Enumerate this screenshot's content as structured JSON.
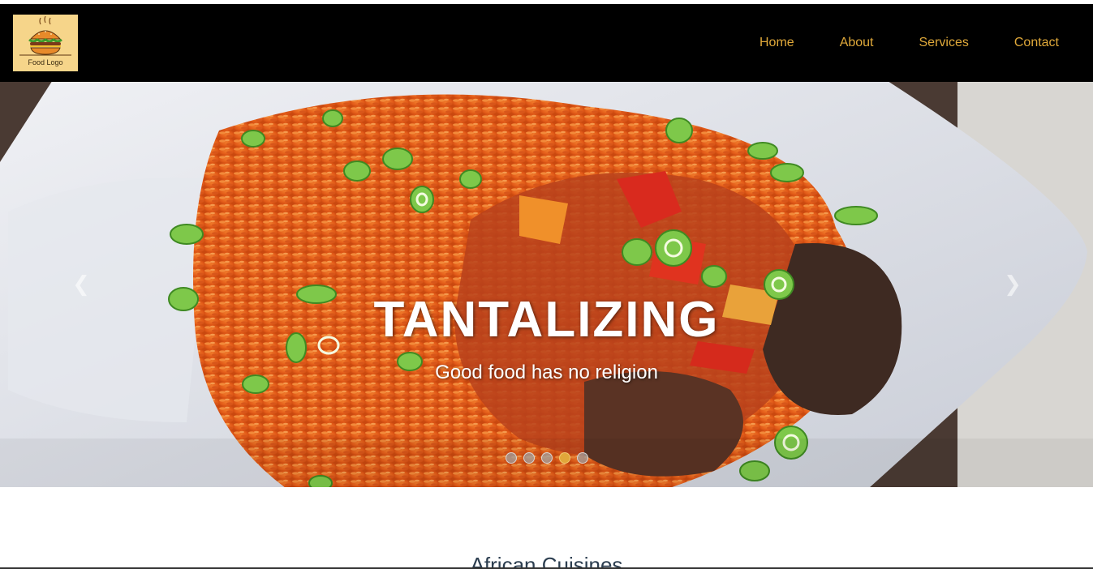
{
  "navbar": {
    "logo_text": "Food Logo",
    "links": [
      "Home",
      "About",
      "Services",
      "Contact"
    ]
  },
  "hero": {
    "title": "TANTALIZING",
    "subtitle": "Good food has no religion",
    "prev_icon": "chevron-left-icon",
    "next_icon": "chevron-right-icon",
    "slide_count": 5,
    "active_slide": 4
  },
  "section": {
    "title": "African Cuisines"
  },
  "colors": {
    "navbar_bg": "#000000",
    "nav_link": "#e0a93a",
    "logo_bg": "#f6d58a",
    "active_dot": "#e1a73a"
  }
}
